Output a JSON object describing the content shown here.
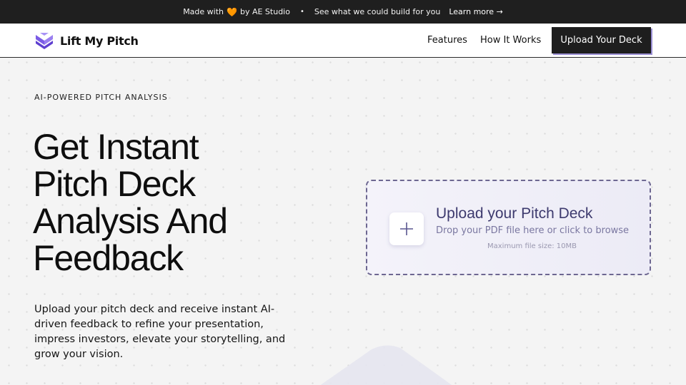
{
  "topbar": {
    "made_with": "Made with",
    "heart_icon": "heart-icon",
    "by": "by AE Studio",
    "separator": "•",
    "pitch": "See what we could build for you",
    "learn_more": "Learn more →"
  },
  "nav": {
    "logo_text": "Lift My Pitch",
    "features": "Features",
    "how_it_works": "How It Works",
    "upload_button": "Upload Your Deck"
  },
  "hero": {
    "eyebrow": "AI-POWERED PITCH ANALYSIS",
    "headline_lines": [
      "Get Instant",
      "Pitch Deck",
      "Analysis And",
      "Feedback"
    ],
    "description": "Upload your pitch deck and receive instant AI-driven feedback to refine your presentation, impress investors, elevate your storytelling, and grow your vision."
  },
  "dropzone": {
    "title": "Upload your Pitch Deck",
    "subtitle": "Drop your PDF file here or click to browse",
    "max_size": "Maximum file size: 10MB",
    "icon": "plus-icon"
  },
  "colors": {
    "brand": "#7b5ce6",
    "topbar_bg": "#1f1f1f",
    "button_bg": "#1e1e1e",
    "accent_text": "#3d3a6e"
  }
}
